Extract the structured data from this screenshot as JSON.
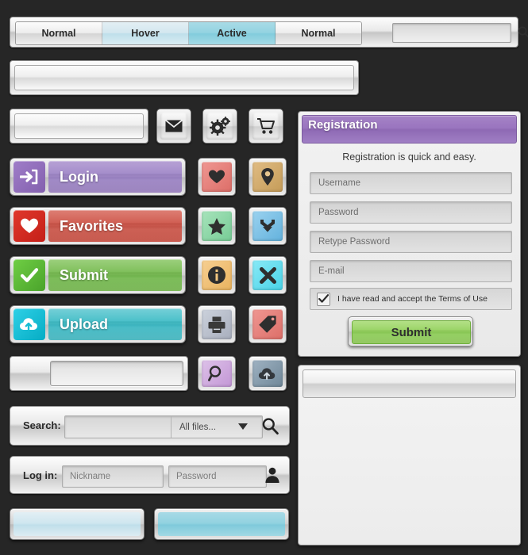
{
  "background_color": "#262626",
  "tab_bar": {
    "tabs": [
      {
        "label": "Normal",
        "state": "normal"
      },
      {
        "label": "Hover",
        "state": "hover"
      },
      {
        "label": "Active",
        "state": "active"
      },
      {
        "label": "Normal",
        "state": "normal"
      }
    ],
    "search_icon": "search-icon",
    "search_value": ""
  },
  "big_bar": {
    "value": ""
  },
  "icon_row": {
    "bar_value": "",
    "buttons": [
      {
        "icon": "mail-icon",
        "color": "#e0e0e0"
      },
      {
        "icon": "gears-icon",
        "color": "#e0e0e0"
      },
      {
        "icon": "shopping-cart-icon",
        "color": "#e0e0e0"
      }
    ]
  },
  "action_buttons": [
    {
      "label": "Login",
      "icon": "login-arrow-icon",
      "icon_color": "#8e6cb8",
      "bar_color": "#9d84c6"
    },
    {
      "label": "Favorites",
      "icon": "heart-icon",
      "icon_color": "#d32a22",
      "bar_color": "#cc5246"
    },
    {
      "label": "Submit",
      "icon": "checkmark-icon",
      "icon_color": "#55b933",
      "bar_color": "#74b94e"
    },
    {
      "label": "Upload",
      "icon": "cloud-upload-icon",
      "icon_color": "#13bcd4",
      "bar_color": "#3bbac4"
    }
  ],
  "square_icons": [
    {
      "icon": "heart-icon",
      "color": "#e8817c"
    },
    {
      "icon": "map-pin-icon",
      "color": "#d3ab6a"
    },
    {
      "icon": "star-icon",
      "color": "#8ed8a8"
    },
    {
      "icon": "download-icon",
      "color": "#7dc2e6"
    },
    {
      "icon": "info-icon",
      "color": "#f0c077"
    },
    {
      "icon": "close-x-icon",
      "color": "#67dff0"
    },
    {
      "icon": "printer-icon",
      "color": "#b8bdc9"
    },
    {
      "icon": "price-tag-icon",
      "color": "#e8827c"
    }
  ],
  "mini_row": {
    "bar_value": "",
    "buttons": [
      {
        "icon": "magnifier-icon",
        "color": "#cda8dd"
      },
      {
        "icon": "cloud-upload-icon",
        "color": "#7f98ab"
      }
    ]
  },
  "search_row": {
    "label": "Search:",
    "value": "",
    "dropdown_value": "All files...",
    "dropdown_caret": "chevron-down-icon",
    "search_icon": "search-icon"
  },
  "login_row": {
    "label": "Log in:",
    "nickname_placeholder": "Nickname",
    "nickname_value": "",
    "password_placeholder": "Password",
    "password_value": "",
    "user_icon": "user-icon"
  },
  "state_bars": [
    {
      "state": "hover"
    },
    {
      "state": "active"
    }
  ],
  "registration": {
    "title": "Registration",
    "subtitle": "Registration is quick and easy.",
    "header_color": "#9a75bf",
    "fields": [
      {
        "placeholder": "Username",
        "value": ""
      },
      {
        "placeholder": "Password",
        "value": ""
      },
      {
        "placeholder": "Retype Password",
        "value": ""
      },
      {
        "placeholder": "E-mail",
        "value": ""
      }
    ],
    "terms_label": "I have read and accept the Terms of Use",
    "terms_checked": true,
    "terms_icon": "checkmark-icon",
    "submit_label": "Submit",
    "submit_color": "#94d15d"
  },
  "empty_panel": {
    "header_value": "",
    "body_value": ""
  }
}
